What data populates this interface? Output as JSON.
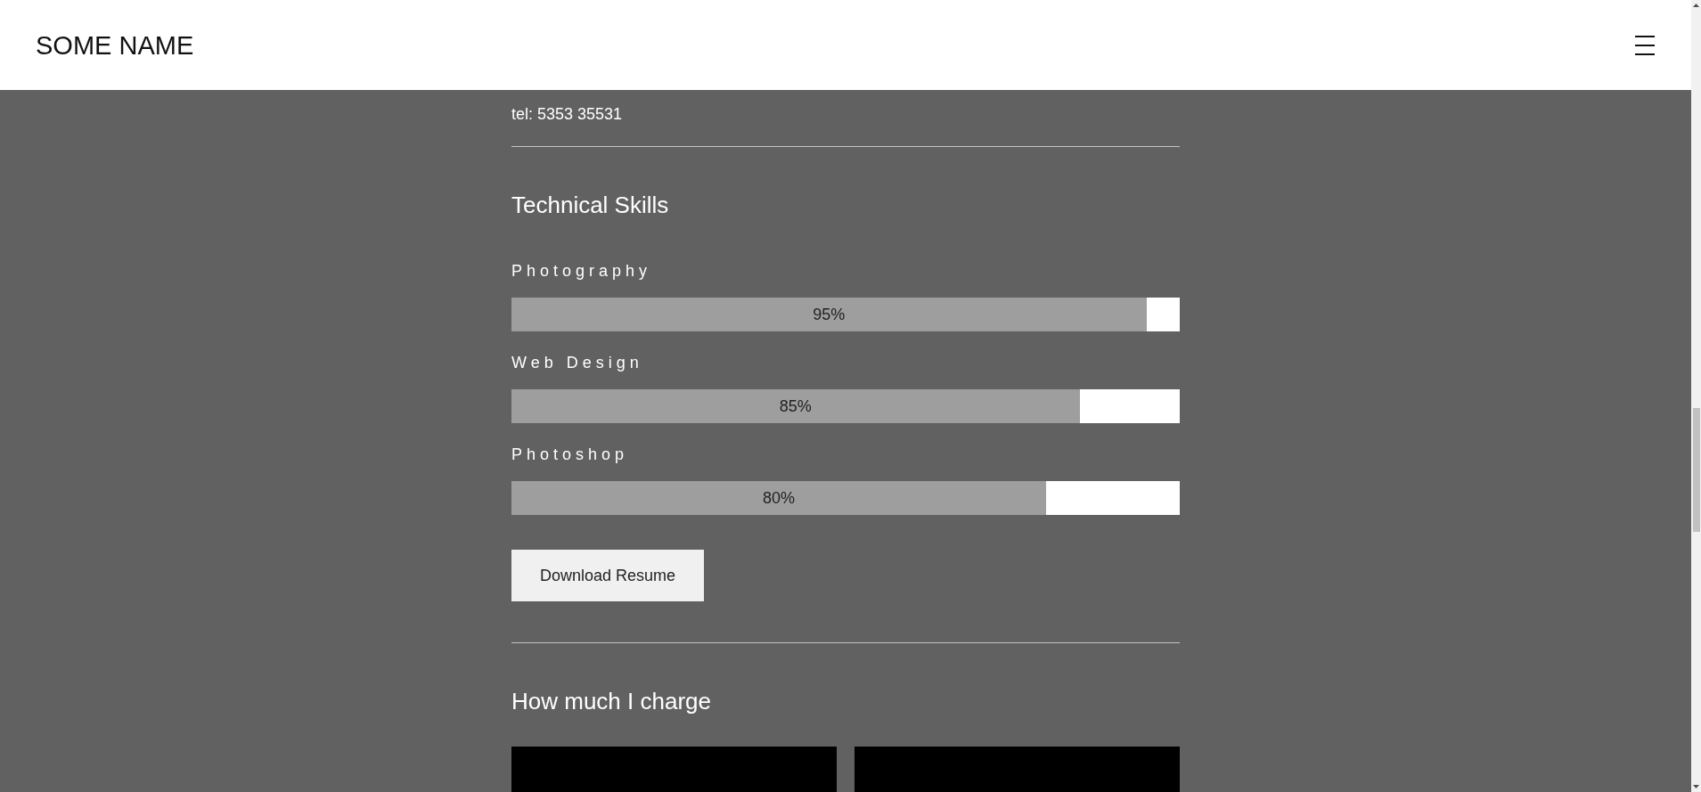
{
  "header": {
    "title": "SOME NAME"
  },
  "contact": {
    "phone": "tel: 5353 35531"
  },
  "skills": {
    "heading": "Technical Skills",
    "items": [
      {
        "name": "Photography",
        "level": 0.95,
        "reading": "95%"
      },
      {
        "name": "Web Design",
        "level": 0.85,
        "reading": "85%"
      },
      {
        "name": "Photoshop",
        "level": 0.8,
        "reading": "80%"
      }
    ]
  },
  "download_button": {
    "label": "Download Resume"
  },
  "pricing": {
    "heading": "How much I charge"
  }
}
